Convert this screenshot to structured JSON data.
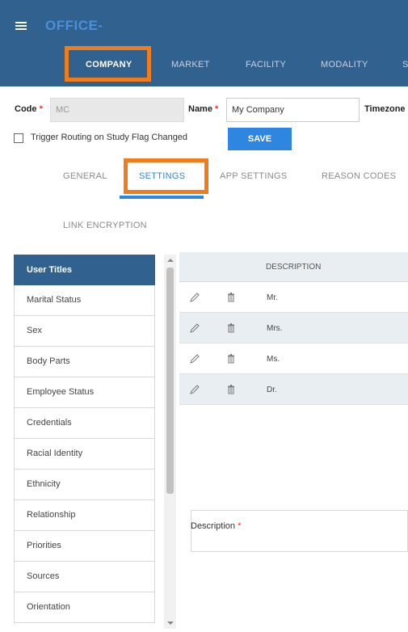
{
  "header": {
    "brand": "OFFICE-",
    "nav_tabs": [
      {
        "label": "COMPANY"
      },
      {
        "label": "MARKET"
      },
      {
        "label": "FACILITY"
      },
      {
        "label": "MODALITY"
      },
      {
        "label": "S"
      }
    ]
  },
  "form": {
    "code_label": "Code",
    "code_value": "MC",
    "name_label": "Name",
    "name_value": "My Company",
    "timezone_label": "Timezone",
    "required_mark": "*",
    "trigger_label": "Trigger Routing on Study Flag Changed",
    "save_label": "SAVE"
  },
  "subtabs": [
    {
      "label": "GENERAL"
    },
    {
      "label": "SETTINGS"
    },
    {
      "label": "APP SETTINGS"
    },
    {
      "label": "REASON CODES"
    },
    {
      "label": "LINK ENCRYPTION"
    }
  ],
  "list": {
    "items": [
      {
        "label": "User Titles"
      },
      {
        "label": "Marital Status"
      },
      {
        "label": "Sex"
      },
      {
        "label": "Body Parts"
      },
      {
        "label": "Employee Status"
      },
      {
        "label": "Credentials"
      },
      {
        "label": "Racial Identity"
      },
      {
        "label": "Ethnicity"
      },
      {
        "label": "Relationship"
      },
      {
        "label": "Priorities"
      },
      {
        "label": "Sources"
      },
      {
        "label": "Orientation"
      }
    ]
  },
  "table": {
    "header": "DESCRIPTION",
    "rows": [
      {
        "description": "Mr."
      },
      {
        "description": "Mrs."
      },
      {
        "description": "Ms."
      },
      {
        "description": "Dr."
      }
    ]
  },
  "detail": {
    "description_label": "Description",
    "required_mark": "*"
  },
  "colors": {
    "header_bg": "#31618f",
    "accent": "#2f86e0",
    "highlight": "#f07c1c"
  }
}
